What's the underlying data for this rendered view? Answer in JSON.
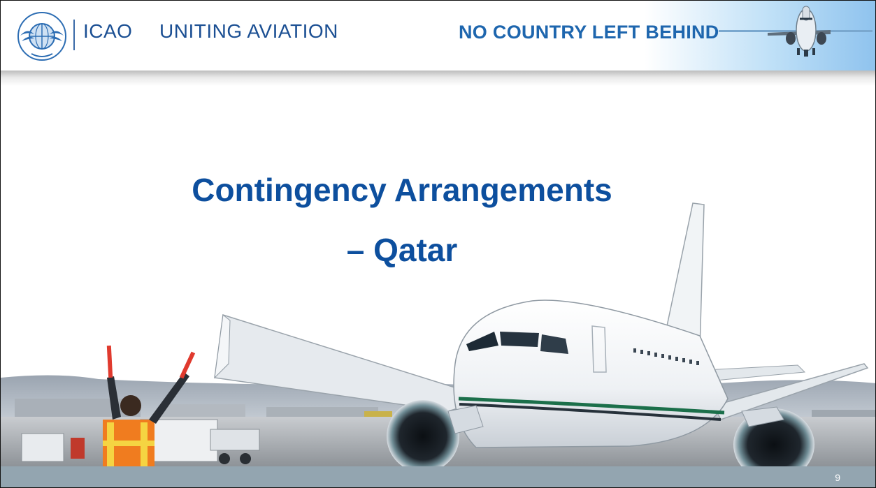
{
  "header": {
    "org": "ICAO",
    "motto": "UNITING AVIATION",
    "tagline": "NO COUNTRY LEFT BEHIND",
    "logo_icon": "icao-emblem-icon",
    "plane_icon": "airplane-icon"
  },
  "title": {
    "line1": "Contingency Arrangements",
    "line2": "– Qatar"
  },
  "footer": {
    "page_number": "9"
  },
  "colors": {
    "title": "#0d4f9e",
    "header_text": "#1b4f93",
    "tagline": "#1e66ae",
    "footer_bar": "#93a5b0"
  }
}
